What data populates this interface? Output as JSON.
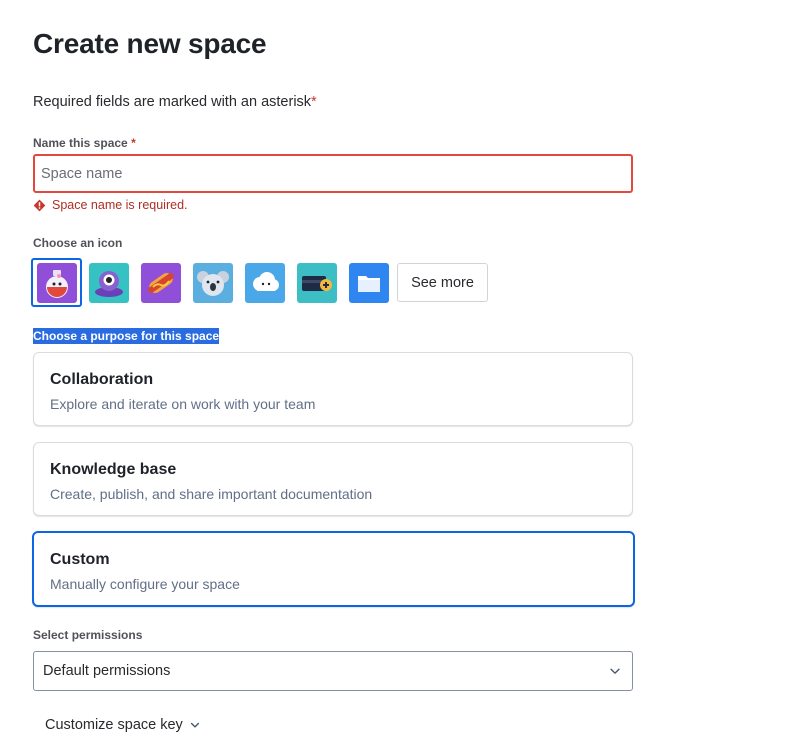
{
  "page": {
    "title": "Create new space",
    "required_note": "Required fields are marked with an asterisk",
    "required_marker": "*"
  },
  "name_field": {
    "label": "Name this space",
    "required_marker": "*",
    "placeholder": "Space name",
    "value": "",
    "error": "Space name is required."
  },
  "icon_picker": {
    "label": "Choose an icon",
    "icons": [
      "potion-icon",
      "robot-icon",
      "hotdog-icon",
      "koala-icon",
      "cloud-icon",
      "wallet-icon",
      "folder-icon"
    ],
    "selected_index": 0,
    "see_more_label": "See more"
  },
  "purpose": {
    "label": "Choose a purpose for this space",
    "options": [
      {
        "title": "Collaboration",
        "description": "Explore and iterate on work with your team"
      },
      {
        "title": "Knowledge base",
        "description": "Create, publish, and share important documentation"
      },
      {
        "title": "Custom",
        "description": "Manually configure your space"
      }
    ],
    "selected": "Custom"
  },
  "permissions": {
    "label": "Select permissions",
    "value": "Default permissions"
  },
  "customize_key_label": "Customize space key",
  "colors": {
    "accent": "#0c66e4",
    "error": "#ae2e24",
    "error_border": "#e2483d"
  }
}
